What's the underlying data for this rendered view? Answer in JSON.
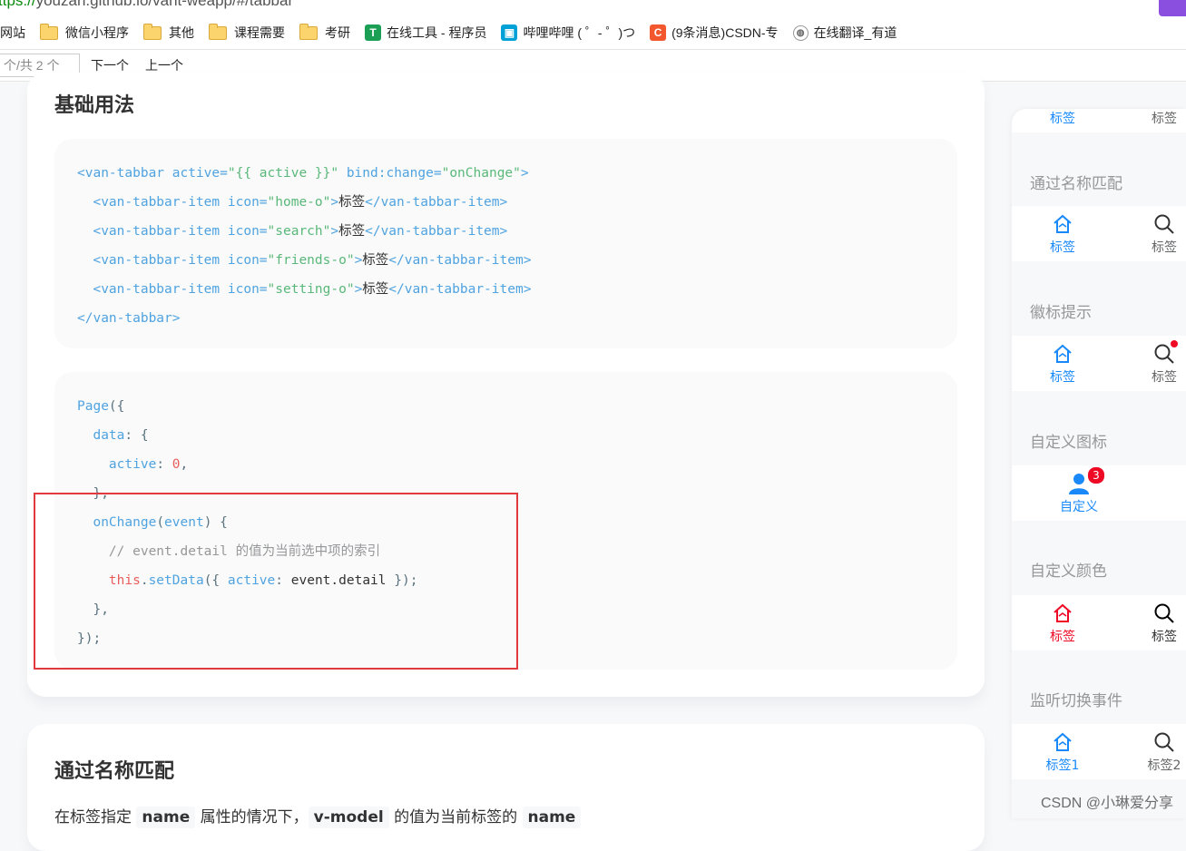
{
  "browser": {
    "url_scheme": "ttps://",
    "url_rest": "youzan.github.io/vant-weapp/#/tabbar",
    "bookmarks": [
      {
        "label": "网站",
        "icon": "none"
      },
      {
        "label": "微信小程序",
        "icon": "folder-icon"
      },
      {
        "label": "其他",
        "icon": "folder-icon"
      },
      {
        "label": "课程需要",
        "icon": "folder-icon"
      },
      {
        "label": "考研",
        "icon": "folder-icon"
      },
      {
        "label": "在线工具 - 程序员",
        "icon": "tool-icon"
      },
      {
        "label": "哔哩哔哩 ( ゜- ゜)つ",
        "icon": "bilibili-icon"
      },
      {
        "label": "(9条消息)CSDN-专",
        "icon": "csdn-icon"
      },
      {
        "label": "在线翻译_有道",
        "icon": "globe-icon"
      }
    ],
    "find": {
      "count": "个/共 2 个",
      "next": "下一个",
      "prev": "上一个"
    }
  },
  "doc": {
    "section1_title": "基础用法",
    "code_block_1": [
      [
        [
          "tag",
          "<van-tabbar "
        ],
        [
          "attr",
          "active="
        ],
        [
          "str",
          "\"{{ active }}\""
        ],
        [
          "attr",
          " bind:change="
        ],
        [
          "str",
          "\"onChange\""
        ],
        [
          "tag",
          ">"
        ]
      ],
      [
        [
          "pun",
          "  "
        ],
        [
          "tag",
          "<van-tabbar-item "
        ],
        [
          "attr",
          "icon="
        ],
        [
          "str",
          "\"home-o\""
        ],
        [
          "tag",
          ">"
        ],
        [
          "txt",
          "标签"
        ],
        [
          "tag",
          "</van-tabbar-item>"
        ]
      ],
      [
        [
          "pun",
          "  "
        ],
        [
          "tag",
          "<van-tabbar-item "
        ],
        [
          "attr",
          "icon="
        ],
        [
          "str",
          "\"search\""
        ],
        [
          "tag",
          ">"
        ],
        [
          "txt",
          "标签"
        ],
        [
          "tag",
          "</van-tabbar-item>"
        ]
      ],
      [
        [
          "pun",
          "  "
        ],
        [
          "tag",
          "<van-tabbar-item "
        ],
        [
          "attr",
          "icon="
        ],
        [
          "str",
          "\"friends-o\""
        ],
        [
          "tag",
          ">"
        ],
        [
          "txt",
          "标签"
        ],
        [
          "tag",
          "</van-tabbar-item>"
        ]
      ],
      [
        [
          "pun",
          "  "
        ],
        [
          "tag",
          "<van-tabbar-item "
        ],
        [
          "attr",
          "icon="
        ],
        [
          "str",
          "\"setting-o\""
        ],
        [
          "tag",
          ">"
        ],
        [
          "txt",
          "标签"
        ],
        [
          "tag",
          "</van-tabbar-item>"
        ]
      ],
      [
        [
          "tag",
          "</van-tabbar>"
        ]
      ]
    ],
    "code_block_2": [
      [
        [
          "fn",
          "Page"
        ],
        [
          "pun",
          "({"
        ]
      ],
      [
        [
          "pun",
          "  "
        ],
        [
          "prop",
          "data"
        ],
        [
          "pun",
          ": {"
        ]
      ],
      [
        [
          "pun",
          "    "
        ],
        [
          "prop",
          "active"
        ],
        [
          "pun",
          ": "
        ],
        [
          "num",
          "0"
        ],
        [
          "pun",
          ","
        ]
      ],
      [
        [
          "pun",
          "  },"
        ]
      ],
      [
        [
          "pun",
          "  "
        ],
        [
          "fn",
          "onChange"
        ],
        [
          "pun",
          "("
        ],
        [
          "prop",
          "event"
        ],
        [
          "pun",
          ") {"
        ]
      ],
      [
        [
          "pun",
          "    "
        ],
        [
          "cmt",
          "// event.detail 的值为当前选中项的索引"
        ]
      ],
      [
        [
          "pun",
          "    "
        ],
        [
          "kw",
          "this"
        ],
        [
          "pun",
          "."
        ],
        [
          "fn",
          "setData"
        ],
        [
          "pun",
          "({ "
        ],
        [
          "prop",
          "active"
        ],
        [
          "pun",
          ": "
        ],
        [
          "txt",
          "event.detail"
        ],
        [
          "pun",
          " });"
        ]
      ],
      [
        [
          "pun",
          "  },"
        ]
      ],
      [
        [
          "pun",
          "});"
        ]
      ]
    ],
    "section2_title": "通过名称匹配",
    "section2_desc_a": "在标签指定 ",
    "section2_desc_chip1": "name",
    "section2_desc_b": " 属性的情况下，",
    "section2_desc_chip2": "v-model",
    "section2_desc_c": " 的值为当前标签的 ",
    "section2_desc_chip3": "name"
  },
  "preview": {
    "top_tabs": [
      "标签",
      "标签"
    ],
    "sections": [
      {
        "title": "通过名称匹配",
        "tabs": [
          "标签",
          "标签"
        ]
      },
      {
        "title": "徽标提示",
        "tabs": [
          "标签",
          "标签"
        ]
      },
      {
        "title": "自定义图标",
        "tabs": [
          "自定义"
        ],
        "badge": "3"
      },
      {
        "title": "自定义颜色",
        "tabs": [
          "标签",
          "标签"
        ]
      },
      {
        "title": "监听切换事件",
        "tabs": [
          "标签1",
          "标签2"
        ]
      }
    ]
  },
  "watermark": "CSDN @小琳爱分享",
  "colors": {
    "active": "#1989fa",
    "red": "#ee0a24",
    "highlight": "#e0393e"
  }
}
